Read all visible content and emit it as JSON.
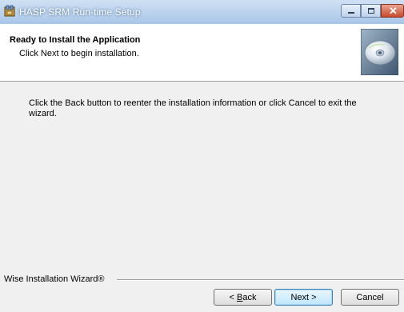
{
  "window": {
    "title": "HASP SRM Run-time Setup",
    "icon": "installer-icon"
  },
  "header": {
    "title": "Ready to Install the Application",
    "subtitle": "Click Next to begin installation.",
    "art": "cd-disc-icon"
  },
  "body": {
    "text": "Click the Back button to reenter the installation information or click Cancel to exit the wizard."
  },
  "footer": {
    "brand": "Wise Installation Wizard®",
    "back_prefix": "< ",
    "back_mnemonic": "B",
    "back_rest": "ack",
    "next_label": "Next >",
    "cancel_label": "Cancel"
  },
  "colors": {
    "titlebar": "#a9c6e8",
    "close_button": "#c74a2c",
    "default_button_border": "#3c7fb1"
  }
}
